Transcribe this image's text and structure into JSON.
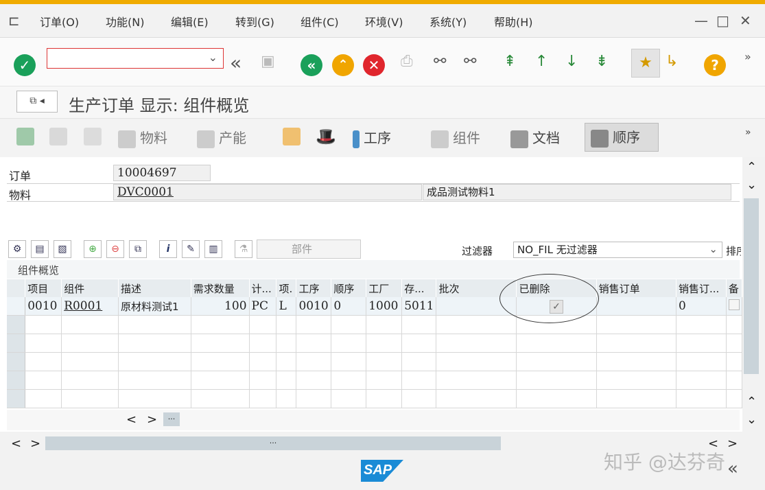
{
  "menu": {
    "items": [
      "订单(O)",
      "功能(N)",
      "编辑(E)",
      "转到(G)",
      "组件(C)",
      "环境(V)",
      "系统(Y)",
      "帮助(H)"
    ]
  },
  "window_controls": {
    "minimize": "—",
    "maximize": "□",
    "close": "✕"
  },
  "toolbar": {
    "command_value": "",
    "more": "»"
  },
  "title": {
    "text": "生产订单 显示: 组件概览"
  },
  "app_toolbar": {
    "material": "物料",
    "capacity": "产能",
    "operations": "工序",
    "components": "组件",
    "documents": "文档",
    "sequences": "顺序",
    "more": "»"
  },
  "header_fields": {
    "order_label": "订单",
    "order_value": "10004697",
    "material_label": "物料",
    "material_value": "DVC0001",
    "material_desc": "成品测试物料1"
  },
  "grid_toolbar": {
    "parts_label": "部件",
    "filter_label": "过滤器",
    "filter_value": "NO_FIL 无过滤器",
    "sort_label": "排序"
  },
  "section_title": "组件概览",
  "table": {
    "columns": [
      "项目",
      "组件",
      "描述",
      "需求数量",
      "计...",
      "项.",
      "工序",
      "顺序",
      "工厂",
      "存...",
      "批次",
      "已删除",
      "销售订单",
      "销售订...",
      "备"
    ],
    "rows": [
      {
        "item": "0010",
        "component": "R0001",
        "description": "原材料测试1",
        "quantity": "100",
        "unit": "PC",
        "item_cat": "L",
        "operation": "0010",
        "sequence": "0",
        "plant": "1000",
        "storage": "5011",
        "batch": "",
        "deleted": true,
        "sales_order": "",
        "sales_item": "0",
        "note": ""
      }
    ]
  },
  "pager": {
    "prev": "<",
    "next": ">",
    "dots": "···"
  },
  "footer": {
    "logo": "SAP",
    "watermark": "知乎 @达芬奇"
  },
  "colors": {
    "accent": "#f0ab00",
    "ok_green": "#1aa05a",
    "cancel_red": "#e0262d",
    "exit_orange": "#f0a500",
    "sap_blue": "#1a8bd6"
  }
}
